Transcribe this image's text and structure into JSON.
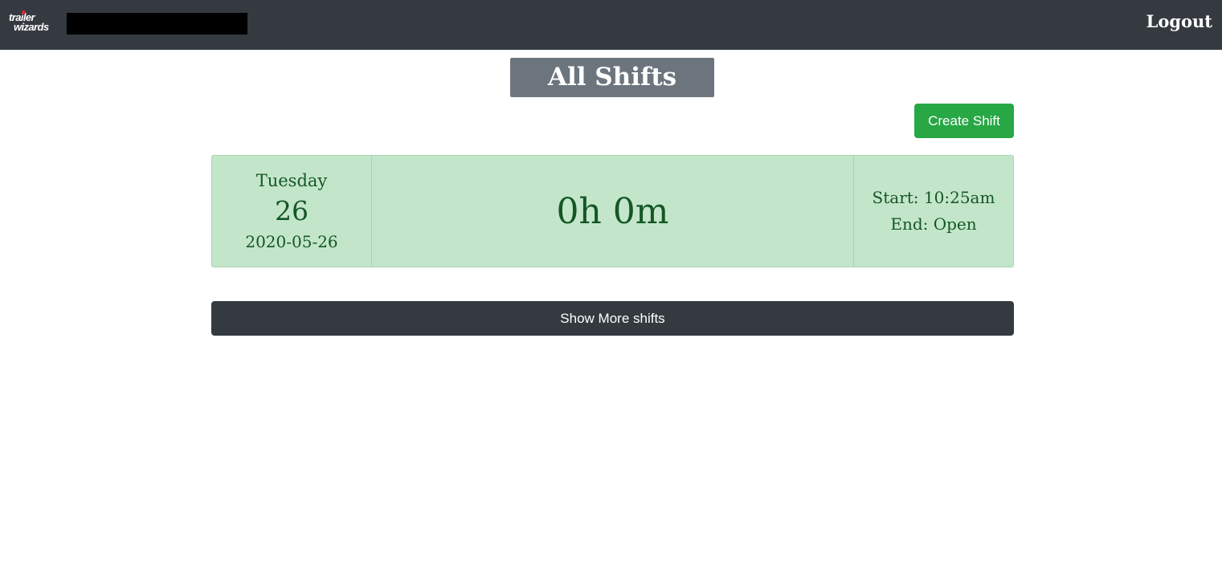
{
  "navbar": {
    "logo_line1": "trailer",
    "logo_line2": "wizards",
    "logout_label": "Logout"
  },
  "page": {
    "title": "All Shifts",
    "create_button_label": "Create Shift",
    "show_more_label": "Show More shifts"
  },
  "shifts": [
    {
      "weekday": "Tuesday",
      "day": "26",
      "date": "2020-05-26",
      "duration": "0h 0m",
      "start": "Start: 10:25am",
      "end": "End: Open"
    }
  ],
  "colors": {
    "navbar": "#343a40",
    "title_bg": "#6c757d",
    "create_button": "#28a745",
    "shift_card_bg": "#c3e6cb",
    "shift_card_text": "#155724",
    "show_more_button": "#343a40"
  }
}
